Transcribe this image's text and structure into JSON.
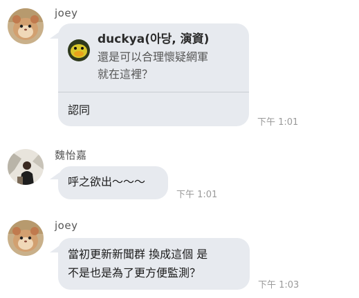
{
  "messages": [
    {
      "sender": "joey",
      "avatar": "hamster-avatar",
      "reply": {
        "name": "duckya(아당, 演資)",
        "lines": [
          "還是可以合理懷疑網軍",
          "就在這裡？"
        ],
        "avatar": "duck-avatar"
      },
      "lines": [
        "認同"
      ],
      "time": "下午 1:01"
    },
    {
      "sender": "魏怡嘉",
      "avatar": "person-avatar",
      "lines": [
        "呼之欲出〜〜〜"
      ],
      "time": "下午 1:01"
    },
    {
      "sender": "joey",
      "avatar": "hamster-avatar",
      "lines": [
        "當初更新新聞群 換成這個 是",
        "不是也是為了更方便監測？"
      ],
      "time": "下午 1:03"
    }
  ],
  "colors": {
    "bubble": "#e7eaef",
    "time": "#999999"
  }
}
